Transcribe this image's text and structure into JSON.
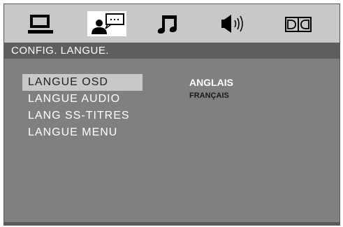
{
  "tabs": [
    {
      "icon": "monitor-icon",
      "selected": false
    },
    {
      "icon": "language-speaker-icon",
      "selected": true
    },
    {
      "icon": "music-note-icon",
      "selected": false
    },
    {
      "icon": "speaker-volume-icon",
      "selected": false
    },
    {
      "icon": "dolby-icon",
      "selected": false
    }
  ],
  "header": {
    "title": "CONFIG. LANGUE."
  },
  "menu": {
    "items": [
      {
        "label": "LANGUE OSD",
        "selected": true
      },
      {
        "label": "LANGUE AUDIO",
        "selected": false
      },
      {
        "label": "LANG SS-TITRES",
        "selected": false
      },
      {
        "label": "LANGUE MENU",
        "selected": false
      }
    ]
  },
  "options": {
    "items": [
      {
        "label": "ANGLAIS",
        "selected": true
      },
      {
        "label": "FRANÇAIS",
        "selected": false
      }
    ]
  },
  "colors": {
    "panel": "#808080",
    "iconbar": "#c8c8c8",
    "titlebar": "#5e5e5e",
    "highlight": "#c8c8c8"
  }
}
